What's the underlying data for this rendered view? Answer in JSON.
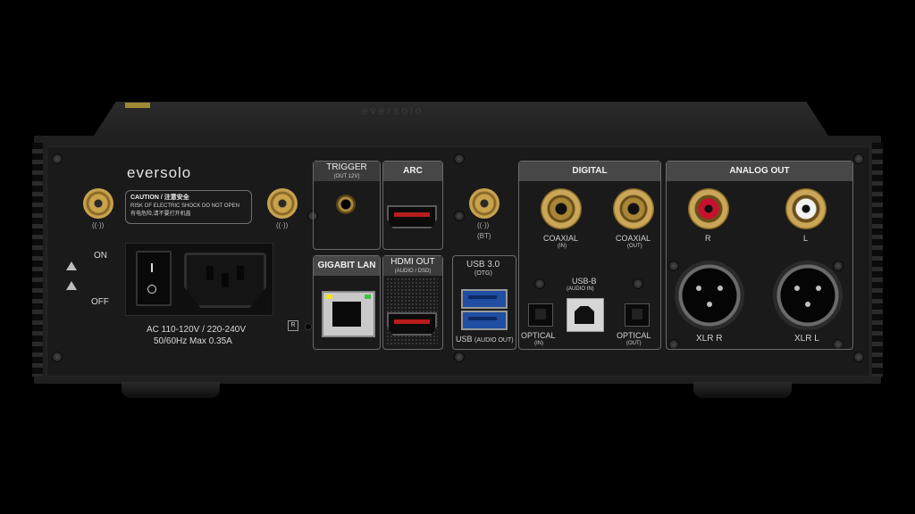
{
  "device": {
    "brand": "eversolo",
    "top_logo": "eversolo"
  },
  "caution": {
    "title": "CAUTION / 注意安全",
    "line1": "RISK OF ELECTRIC SHOCK DO NOT OPEN",
    "line2": "有电危险,请不要打开机盖"
  },
  "power": {
    "on_label": "ON",
    "off_label": "OFF",
    "spec_line1": "AC 110-120V / 220-240V",
    "spec_line2": "50/60Hz Max 0.35A"
  },
  "antenna": {
    "bt_label": "(BT)"
  },
  "sections": {
    "trigger": {
      "title": "TRIGGER",
      "subtitle": "(OUT 12V)"
    },
    "arc": {
      "title": "ARC"
    },
    "gigabit_lan": {
      "title": "GIGABIT LAN"
    },
    "hdmi_out": {
      "title": "HDMI OUT",
      "subtitle": "(AUDIO / DSD)"
    },
    "usb30": {
      "title": "USB 3.0",
      "subtitle": "(OTG)",
      "bottom": "USB",
      "bottom_sub": "(AUDIO OUT)"
    },
    "digital": {
      "title": "DIGITAL",
      "coax_in": "COAXIAL",
      "coax_in_sub": "(IN)",
      "coax_out": "COAXIAL",
      "coax_out_sub": "(OUT)",
      "usbb": "USB-B",
      "usbb_sub": "(AUDIO IN)",
      "opt_in": "OPTICAL",
      "opt_in_sub": "(IN)",
      "opt_out": "OPTICAL",
      "opt_out_sub": "(OUT)"
    },
    "analog_out": {
      "title": "ANALOG OUT",
      "rca_r": "R",
      "rca_l": "L",
      "xlr_r": "XLR R",
      "xlr_l": "XLR L"
    }
  },
  "marks": {
    "r": "R"
  },
  "colors": {
    "gold": "#c9a24a",
    "red_rca": "#c8102e",
    "usb_blue": "#1f4ea3",
    "hdmi_red": "#b81c1c"
  }
}
